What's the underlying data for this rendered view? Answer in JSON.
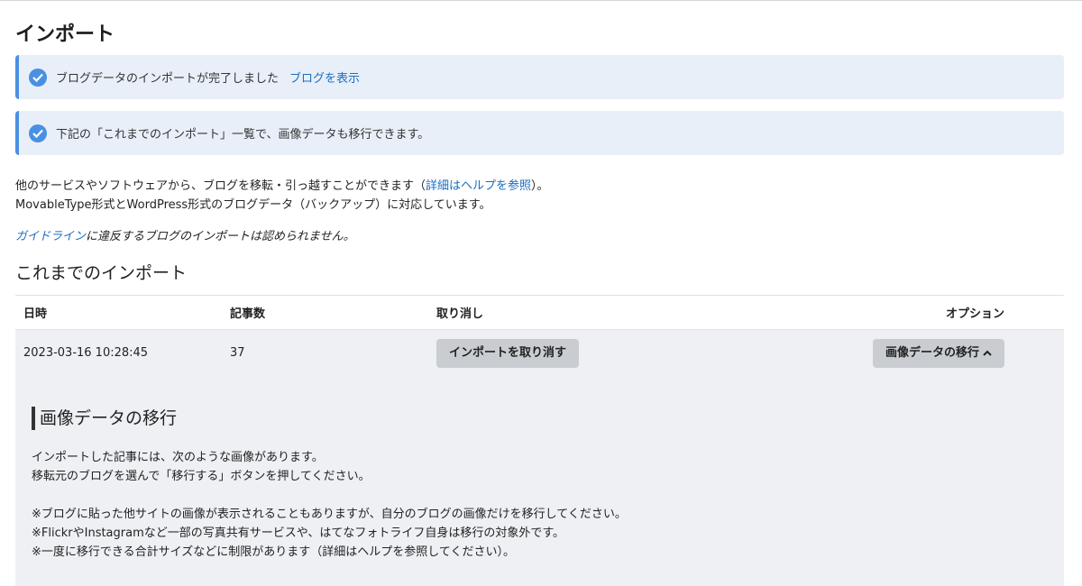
{
  "page": {
    "title": "インポート"
  },
  "notices": [
    {
      "text": "ブログデータのインポートが完了しました",
      "link": "ブログを表示"
    },
    {
      "text": "下記の「これまでのインポート」一覧で、画像データも移行できます。"
    }
  ],
  "intro": {
    "line1_pre": "他のサービスやソフトウェアから、ブログを移転・引っ越すことができます（",
    "line1_link": "詳細はヘルプを参照",
    "line1_post": "）。",
    "line2": "MovableType形式とWordPress形式のブログデータ（バックアップ）に対応しています。"
  },
  "guideline": {
    "link": "ガイドライン",
    "text": "に違反するブログのインポートは認められません。"
  },
  "history": {
    "title": "これまでのインポート",
    "columns": [
      "日時",
      "記事数",
      "取り消し",
      "オプション"
    ],
    "rows": [
      {
        "datetime": "2023-03-16 10:28:45",
        "count": "37",
        "cancel_label": "インポートを取り消す",
        "option_label": "画像データの移行"
      }
    ]
  },
  "migration": {
    "title": "画像データの移行",
    "lines": [
      "インポートした記事には、次のような画像があります。",
      "移転元のブログを選んで「移行する」ボタンを押してください。"
    ],
    "notes": [
      "※ブログに貼った他サイトの画像が表示されることもありますが、自分のブログの画像だけを移行してください。",
      "※FlickrやInstagramなど一部の写真共有サービスや、はてなフォトライフ自身は移行の対象外です。",
      "※一度に移行できる合計サイズなどに制限があります（詳細はヘルプを参照してください）。"
    ]
  },
  "colors": {
    "accent": "#4a90e2",
    "link": "#1a6ec2",
    "notice_bg": "#e8eff8",
    "row_bg": "#eef0f4",
    "button_bg": "#c9ccd1"
  },
  "icons": {
    "notice": "check-circle-icon",
    "expand": "chevron-up-icon"
  }
}
